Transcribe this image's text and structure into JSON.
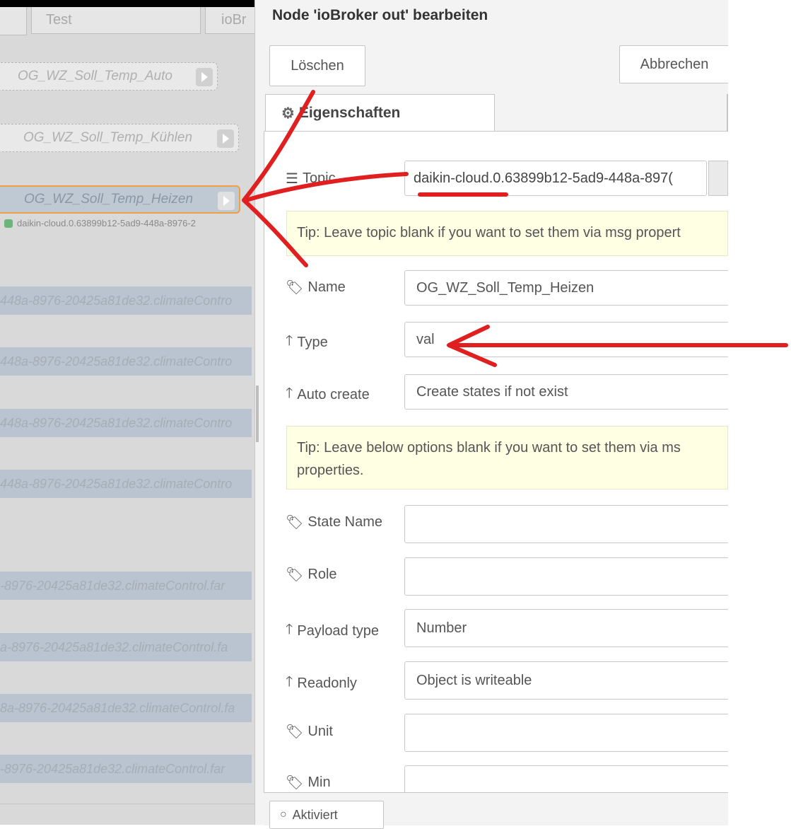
{
  "canvas": {
    "tabs": [
      {
        "label": "Test"
      },
      {
        "label": "ioBr"
      }
    ],
    "nodes": [
      {
        "label": "OG_WZ_Soll_Temp_Auto"
      },
      {
        "label": "OG_WZ_Soll_Temp_Kühlen"
      },
      {
        "label": "OG_WZ_Soll_Temp_Heizen"
      }
    ],
    "status_text": "daikin-cloud.0.63899b12-5ad9-448a-8976-2",
    "wire_labels": [
      "448a-8976-20425a81de32.climateContro",
      "448a-8976-20425a81de32.climateContro",
      "448a-8976-20425a81de32.climateContro",
      "448a-8976-20425a81de32.climateContro",
      "-8976-20425a81de32.climateControl.far",
      "a-8976-20425a81de32.climateControl.fa",
      "8a-8976-20425a81de32.climateControl.fa",
      "-8976-20425a81de32.climateControl.far"
    ]
  },
  "dialog": {
    "title": "Node 'ioBroker out' bearbeiten",
    "delete_label": "Löschen",
    "cancel_label": "Abbrechen",
    "tab_label": "Eigenschaften",
    "topic_label": "Topic",
    "topic_value": "daikin-cloud.0.63899b12-5ad9-448a-897(",
    "tip1": "Tip: Leave topic blank if you want to set them via msg propert",
    "name_label": "Name",
    "name_value": "OG_WZ_Soll_Temp_Heizen",
    "type_label": "Type",
    "type_value": "val",
    "autocreate_label": "Auto create",
    "autocreate_value": "Create states if not exist",
    "tip2_line1": "Tip: Leave below options blank if you want to set them via ms",
    "tip2_line2": "properties.",
    "statename_label": "State Name",
    "role_label": "Role",
    "payloadtype_label": "Payload type",
    "payloadtype_value": "Number",
    "readonly_label": "Readonly",
    "readonly_value": "Object is writeable",
    "unit_label": "Unit",
    "min_label": "Min",
    "footer_label": "Aktiviert"
  },
  "colors": {
    "annotation": "#e02020",
    "tip_bg": "#ffffe4",
    "selected_node_border": "#f0a040"
  }
}
